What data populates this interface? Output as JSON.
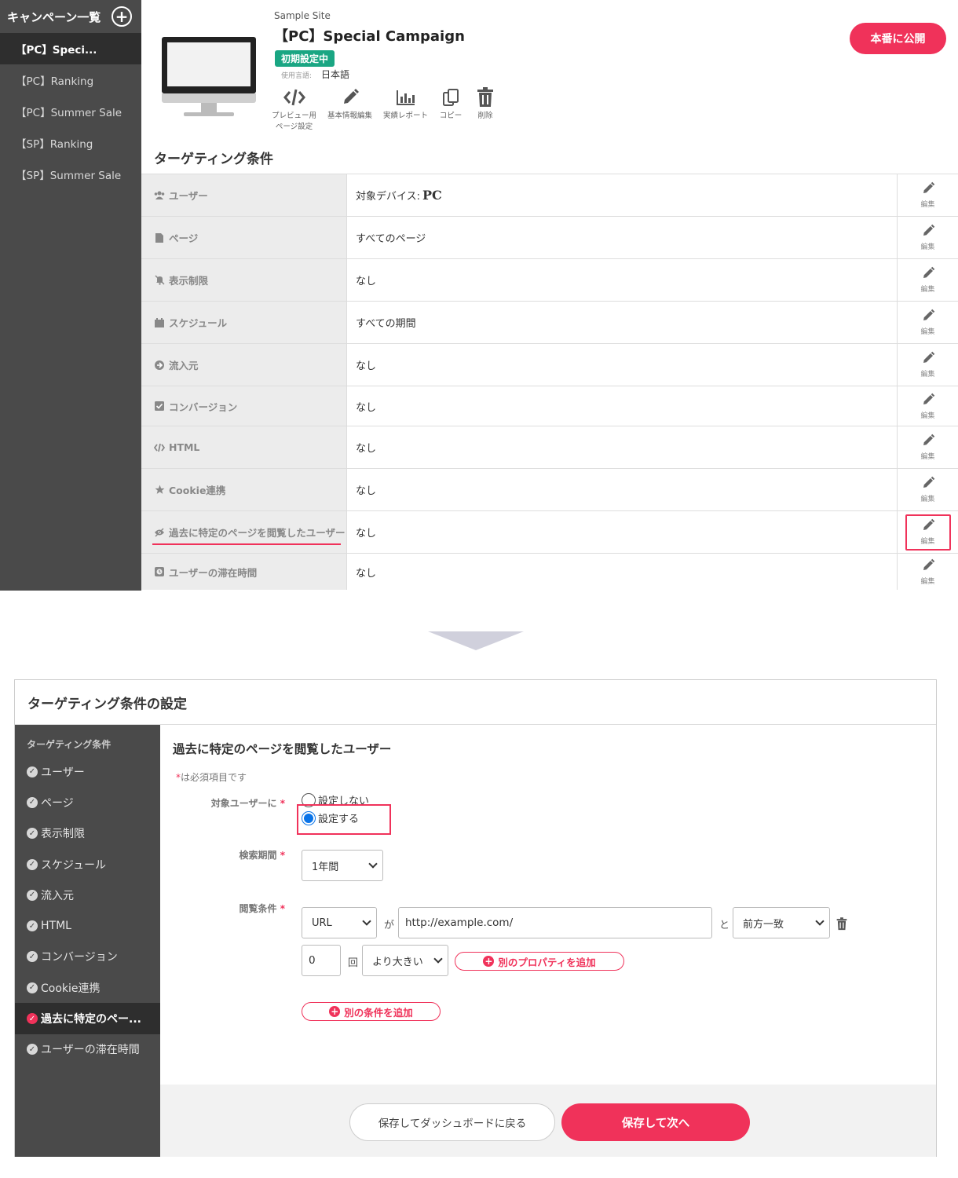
{
  "sidebar": {
    "title": "キャンペーン一覧",
    "add_icon": "plus-circle-icon",
    "items": [
      {
        "label": "【PC】Speci...",
        "active": true
      },
      {
        "label": "【PC】Ranking"
      },
      {
        "label": "【PC】Summer Sale"
      },
      {
        "label": "【SP】Ranking"
      },
      {
        "label": "【SP】Summer Sale"
      }
    ]
  },
  "campaign": {
    "site_name": "Sample Site",
    "title": "【PC】Special Campaign",
    "status": "初期設定中",
    "language_label": "使用言語:",
    "language_value": "日本語",
    "publish_label": "本番に公開",
    "tools": [
      {
        "icon": "code-icon",
        "label": "プレビュー用\nページ設定"
      },
      {
        "icon": "pencil-icon",
        "label": "基本情報編集"
      },
      {
        "icon": "bar-chart-icon",
        "label": "実績レポート"
      },
      {
        "icon": "copy-icon",
        "label": "コピー"
      },
      {
        "icon": "trash-icon",
        "label": "削除"
      }
    ]
  },
  "targeting": {
    "section_title": "ターゲティング条件",
    "edit_label": "編集",
    "rows": [
      {
        "icon": "users-icon",
        "label": "ユーザー",
        "value": "対象デバイス:",
        "value_emph": "PC"
      },
      {
        "icon": "file-icon",
        "label": "ページ",
        "value": "すべてのページ"
      },
      {
        "icon": "bell-slash-icon",
        "label": "表示制限",
        "value": "なし"
      },
      {
        "icon": "calendar-icon",
        "label": "スケジュール",
        "value": "すべての期間"
      },
      {
        "icon": "arrow-circle-icon",
        "label": "流入元",
        "value": "なし"
      },
      {
        "icon": "check-square-icon",
        "label": "コンバージョン",
        "value": "なし"
      },
      {
        "icon": "code-icon",
        "label": "HTML",
        "value": "なし"
      },
      {
        "icon": "star-icon",
        "label": "Cookie連携",
        "value": "なし"
      },
      {
        "icon": "eye-slash-icon",
        "label": "過去に特定のページを閲覧したユーザー",
        "value": "なし",
        "highlighted": true
      },
      {
        "icon": "clock-icon",
        "label": "ユーザーの滞在時間",
        "value": "なし"
      }
    ]
  },
  "modal": {
    "title": "ターゲティング条件の設定",
    "side_title": "ターゲティング条件",
    "side_items": [
      {
        "label": "ユーザー"
      },
      {
        "label": "ページ"
      },
      {
        "label": "表示制限"
      },
      {
        "label": "スケジュール"
      },
      {
        "label": "流入元"
      },
      {
        "label": "HTML"
      },
      {
        "label": "コンバージョン"
      },
      {
        "label": "Cookie連携"
      },
      {
        "label": "過去に特定のペー...",
        "active": true
      },
      {
        "label": "ユーザーの滞在時間"
      }
    ],
    "form": {
      "heading": "過去に特定のページを閲覧したユーザー",
      "required_note": "は必須項目です",
      "required_mark": "*",
      "target_label": "対象ユーザーに",
      "radio_off": "設定しない",
      "radio_on": "設定する",
      "radio_selected": "設定する",
      "period_label": "検索期間",
      "period_value": "1年間",
      "condition_label": "閲覧条件",
      "property_value": "URL",
      "joiner_ga": "が",
      "url_value": "http://example.com/",
      "joiner_to": "と",
      "match_value": "前方一致",
      "count_value": "0",
      "count_unit": "回",
      "compare_value": "より大きい",
      "add_property_label": "別のプロパティを追加",
      "add_condition_label": "別の条件を追加"
    },
    "footer": {
      "back_label": "保存してダッシュボードに戻る",
      "next_label": "保存して次へ"
    }
  },
  "colors": {
    "accent": "#f0325a",
    "status_green": "#1aa683",
    "sidebar_bg": "#4a4a4a",
    "radio_blue": "#0a74e8"
  }
}
